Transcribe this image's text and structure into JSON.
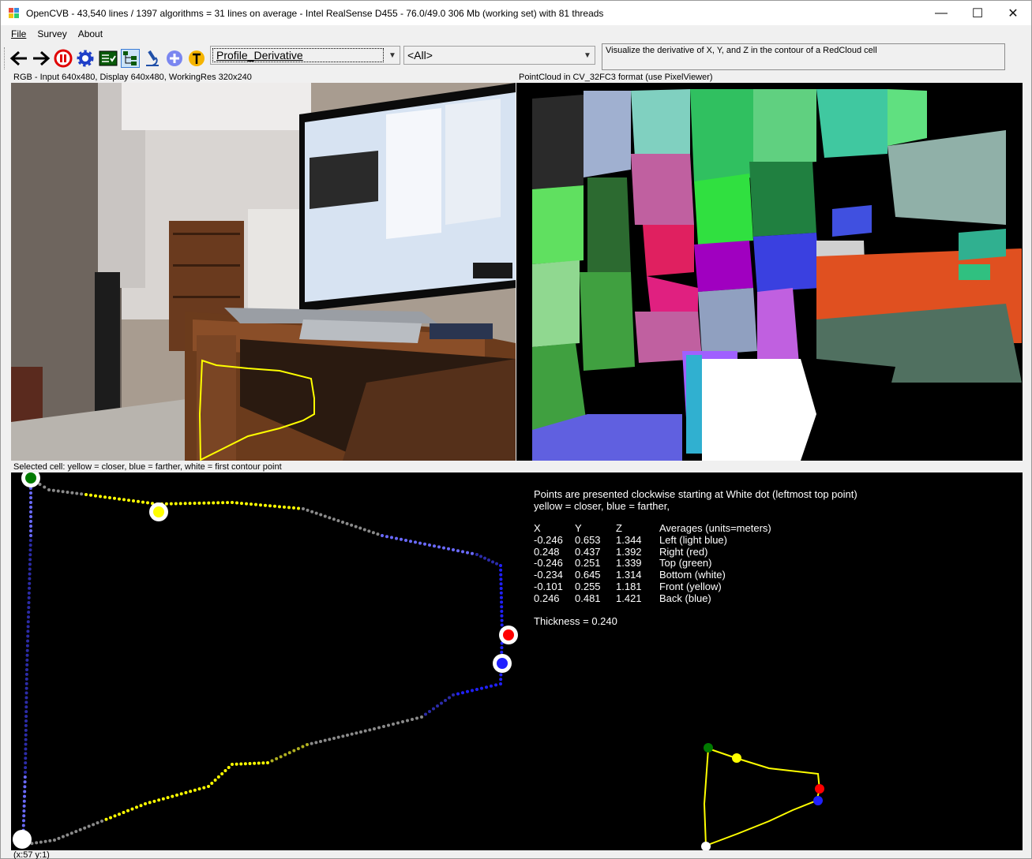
{
  "window": {
    "title": "OpenCVB - 43,540 lines / 1397 algorithms = 31 lines on average - Intel RealSense D455 - 76.0/49.0 306 Mb (working set) with 81 threads",
    "minimize": "—",
    "maximize": "☐",
    "close": "✕"
  },
  "menu": {
    "file": "File",
    "survey": "Survey",
    "about": "About"
  },
  "toolbar": {
    "icons": [
      "back-arrow-icon",
      "forward-arrow-icon",
      "pause-icon",
      "settings-gear-icon",
      "test-all-icon",
      "algorithm-tree-icon",
      "microscope-icon",
      "add-plus-icon",
      "translate-t-icon"
    ],
    "algorithm": "Profile_Derivative",
    "group": "<All>",
    "description": "Visualize the derivative of X, Y, and Z in the contour of a RedCloud cell"
  },
  "captions": {
    "rgb": "RGB - Input 640x480, Display 640x480, WorkingRes 320x240",
    "pointcloud": "PointCloud in CV_32FC3 format (use PixelViewer)",
    "selected": "Selected cell:  yellow = closer, blue = farther, white = first contour point",
    "status": "(x:57 y:1)"
  },
  "output": {
    "line1": "Points are presented clockwise starting at White dot (leftmost top point)",
    "line2": "yellow = closer, blue = farther,",
    "headers": {
      "x": "X",
      "y": "Y",
      "z": "Z",
      "label": "Averages (units=meters)"
    },
    "rows": [
      {
        "x": "-0.246",
        "y": "0.653",
        "z": "1.344",
        "label": "Left (light blue)"
      },
      {
        "x": "0.248",
        "y": "0.437",
        "z": "1.392",
        "label": "Right (red)"
      },
      {
        "x": "-0.246",
        "y": "0.251",
        "z": "1.339",
        "label": "Top (green)"
      },
      {
        "x": "-0.234",
        "y": "0.645",
        "z": "1.314",
        "label": "Bottom (white)"
      },
      {
        "x": "-0.101",
        "y": "0.255",
        "z": "1.181",
        "label": "Front (yellow)"
      },
      {
        "x": "0.246",
        "y": "0.481",
        "z": "1.421",
        "label": "Back (blue)"
      }
    ],
    "thickness": "Thickness = 0.240"
  },
  "colors": {
    "yellow": "#ffff00",
    "blue": "#2020ff",
    "green": "#007a00",
    "red": "#ff0000",
    "white": "#ffffff"
  }
}
